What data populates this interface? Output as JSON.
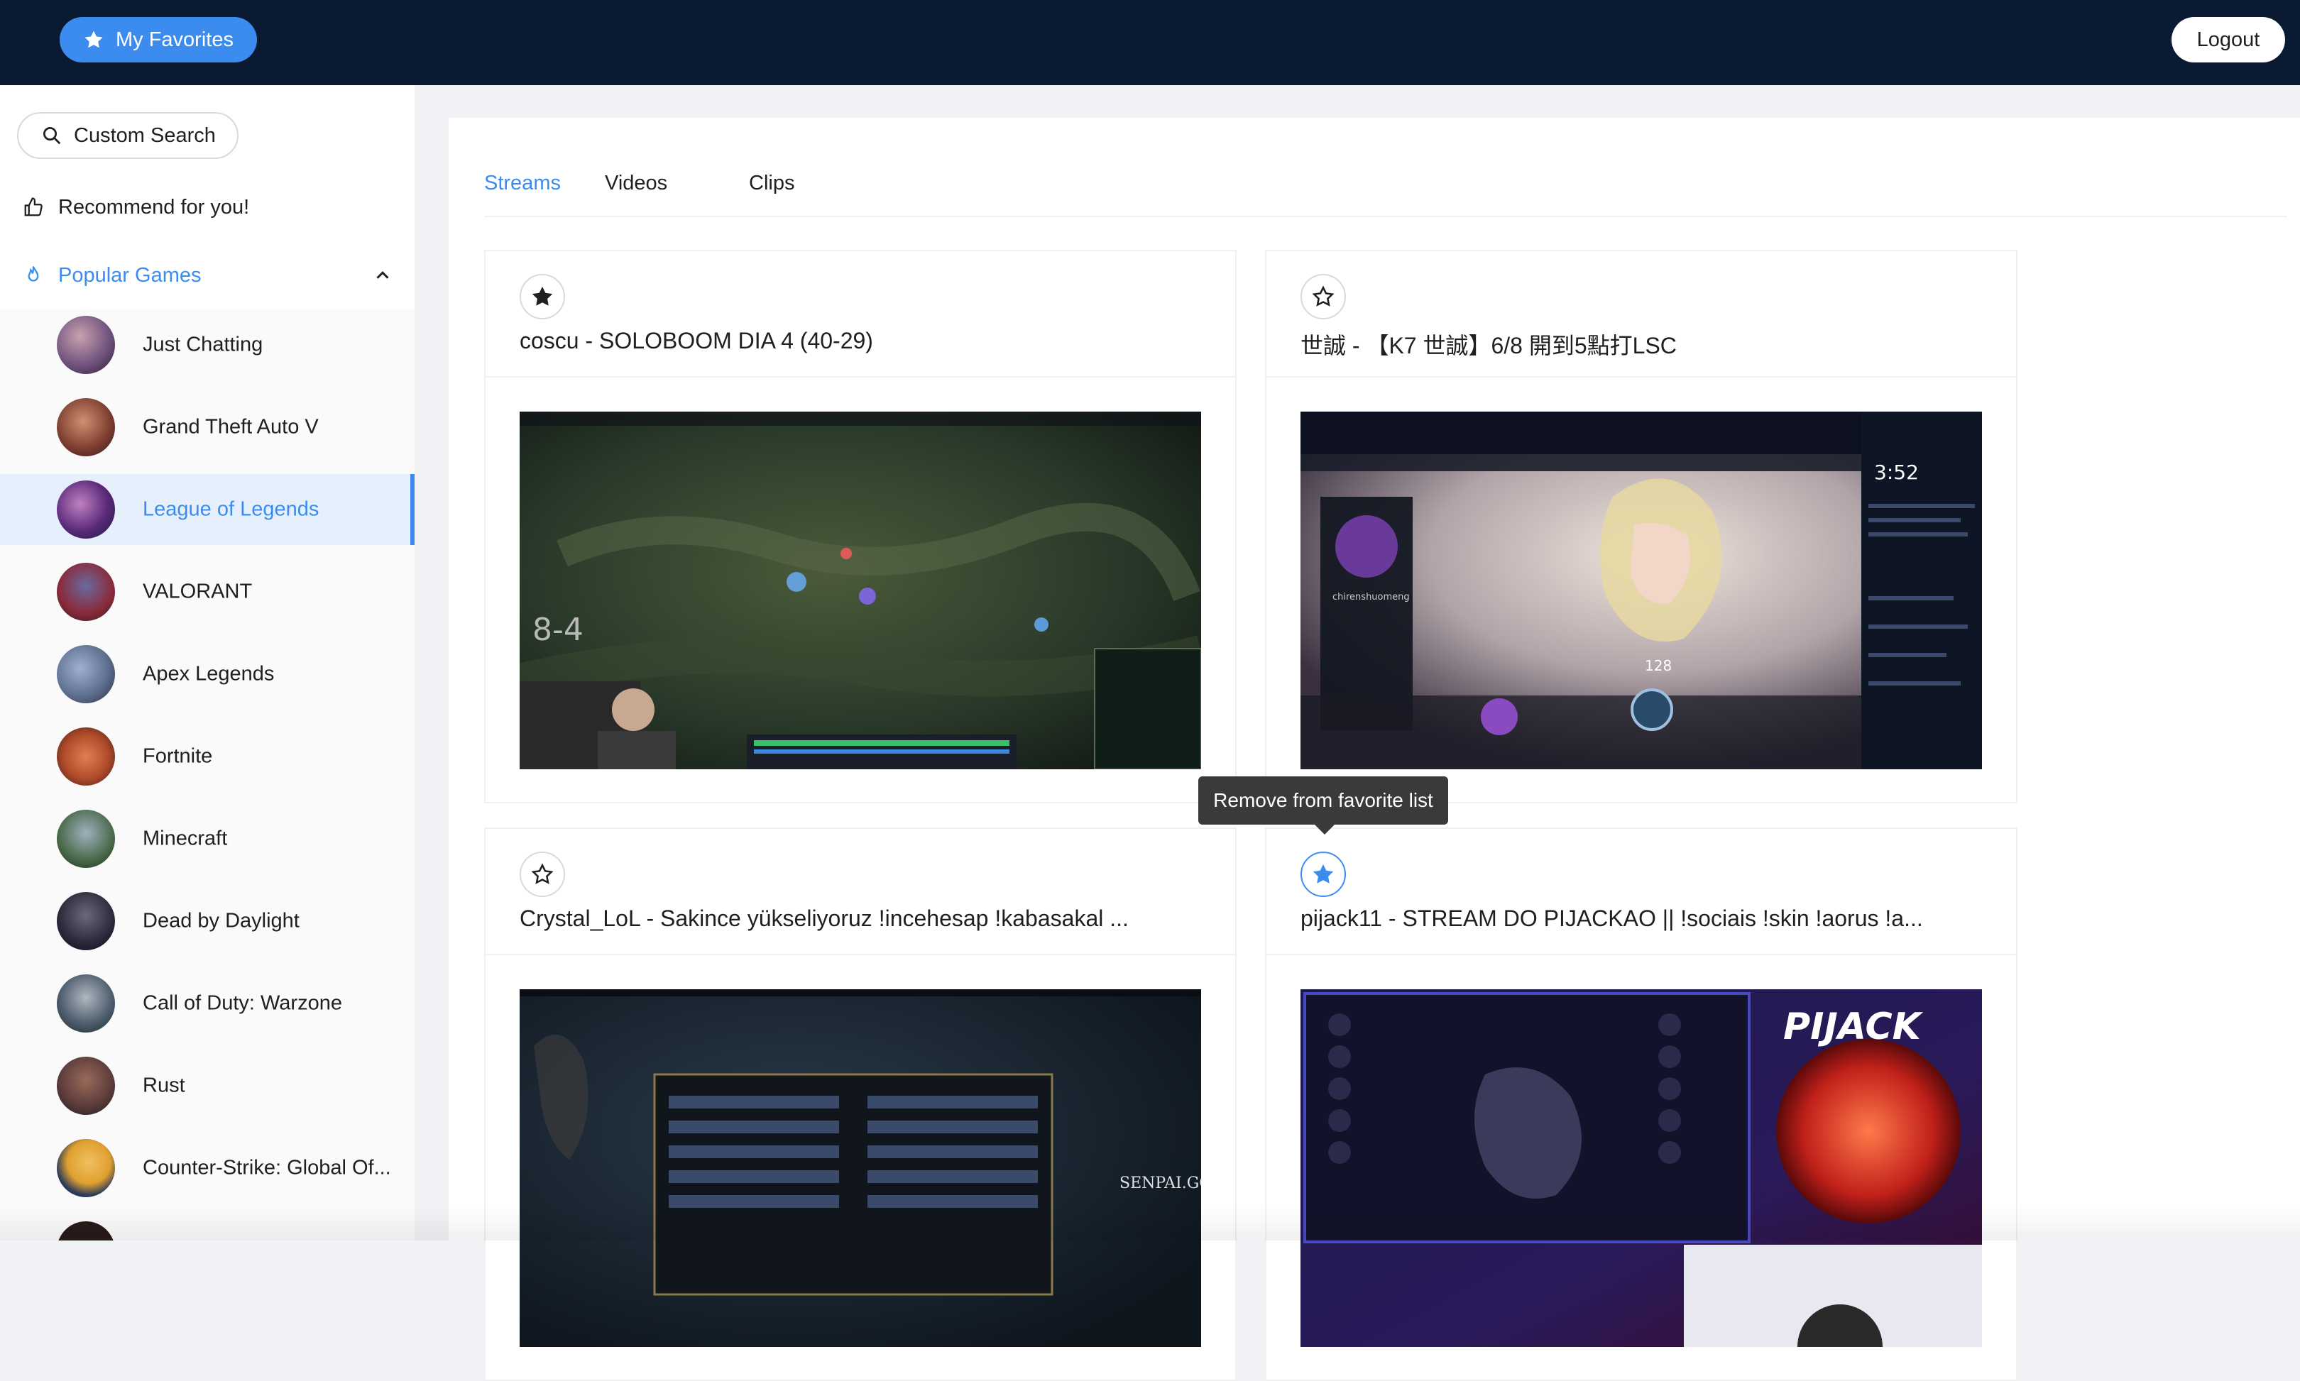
{
  "header": {
    "favorites_label": "My Favorites",
    "logout_label": "Logout"
  },
  "sidebar": {
    "search_label": "Custom Search",
    "recommend_label": "Recommend for you!",
    "popular_label": "Popular Games",
    "games": [
      {
        "label": "Just Chatting",
        "color": "#6b4f7a"
      },
      {
        "label": "Grand Theft Auto V",
        "color": "#7a3b2e"
      },
      {
        "label": "League of Legends",
        "color": "#2a3a6b",
        "active": true
      },
      {
        "label": "VALORANT",
        "color": "#8a2a3a"
      },
      {
        "label": "Apex Legends",
        "color": "#5a6a8a"
      },
      {
        "label": "Fortnite",
        "color": "#b04a2a"
      },
      {
        "label": "Minecraft",
        "color": "#4a6a4a"
      },
      {
        "label": "Dead by Daylight",
        "color": "#2a2a3a"
      },
      {
        "label": "Call of Duty: Warzone",
        "color": "#4a5a6a"
      },
      {
        "label": "Rust",
        "color": "#5a3a3a"
      },
      {
        "label": "Counter-Strike: Global Of...",
        "color": "#e0a030"
      }
    ]
  },
  "tabs": [
    {
      "label": "Streams",
      "active": true
    },
    {
      "label": "Videos"
    },
    {
      "label": "Clips"
    }
  ],
  "streams": [
    {
      "title": "coscu - SOLOBOOM DIA 4 (40-29)",
      "favorited": true
    },
    {
      "title": "世誠 - 【K7 世誠】6/8 開到5點打LSC",
      "favorited": false
    },
    {
      "title": "Crystal_LoL - Sakince yükseliyoruz !incehesap !kabasakal ...",
      "favorited": false
    },
    {
      "title": "pijack11 - STREAM DO PIJACKAO || !sociais !skin !aorus !a...",
      "favorited": false,
      "focused": true
    }
  ],
  "thumb_text": {
    "score": "8-4",
    "timer": "3:52",
    "player": "chirenshuomeng",
    "number": "128",
    "brand": "PIJACK",
    "watermark": "SENPAI.GG"
  },
  "tooltip": "Remove from favorite list"
}
